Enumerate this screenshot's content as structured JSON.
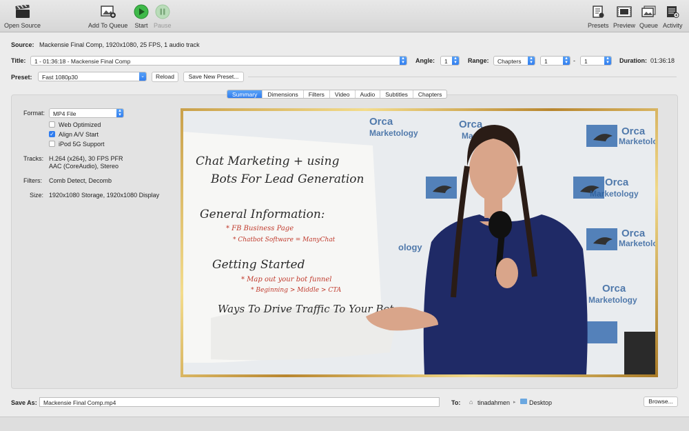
{
  "toolbar": {
    "open_source": "Open Source",
    "add_to_queue": "Add To Queue",
    "start": "Start",
    "pause": "Pause",
    "presets": "Presets",
    "preview": "Preview",
    "queue": "Queue",
    "activity": "Activity"
  },
  "source": {
    "label": "Source:",
    "value": "Mackensie Final Comp, 1920x1080, 25 FPS, 1 audio track"
  },
  "title_row": {
    "label": "Title:",
    "value": "1 - 01:36:18 - Mackensie Final Comp",
    "angle_label": "Angle:",
    "angle_value": "1",
    "range_label": "Range:",
    "range_type": "Chapters",
    "range_start": "1",
    "range_sep": "-",
    "range_end": "1",
    "duration_label": "Duration:",
    "duration_value": "01:36:18"
  },
  "preset_row": {
    "label": "Preset:",
    "value": "Fast 1080p30",
    "reload": "Reload",
    "save_new": "Save New Preset..."
  },
  "tabs": [
    {
      "label": "Summary",
      "active": true
    },
    {
      "label": "Dimensions",
      "active": false
    },
    {
      "label": "Filters",
      "active": false
    },
    {
      "label": "Video",
      "active": false
    },
    {
      "label": "Audio",
      "active": false
    },
    {
      "label": "Subtitles",
      "active": false
    },
    {
      "label": "Chapters",
      "active": false
    }
  ],
  "summary": {
    "format_label": "Format:",
    "format_value": "MP4 File",
    "web_optimized": {
      "label": "Web Optimized",
      "checked": false
    },
    "align_av": {
      "label": "Align A/V Start",
      "checked": true
    },
    "ipod": {
      "label": "iPod 5G Support",
      "checked": false
    },
    "tracks_label": "Tracks:",
    "tracks_line1": "H.264 (x264), 30 FPS PFR",
    "tracks_line2": "AAC (CoreAudio), Stereo",
    "filters_label": "Filters:",
    "filters_value": "Comb Detect, Decomb",
    "size_label": "Size:",
    "size_value": "1920x1080 Storage, 1920x1080 Display"
  },
  "preview_image": {
    "whiteboard": {
      "line1": "Chat Marketing + using",
      "line2": "Bots For Lead Generation",
      "line3": "General Information:",
      "line4": "* FB Business Page",
      "line5": "* Chatbot Software = ManyChat",
      "line6": "Getting Started",
      "line7": "* Map out your bot funnel",
      "line8": "* Beginning > Middle > CTA",
      "line9": "Ways To Drive Traffic To Your Bot"
    },
    "logo_top": "Orca",
    "logo_bottom": "Marketology",
    "logo_small": "ology"
  },
  "save_row": {
    "label": "Save As:",
    "value": "Mackensie Final Comp.mp4",
    "to_label": "To:",
    "user": "tinadahmen",
    "sep": "▸",
    "folder": "Desktop",
    "browse": "Browse..."
  },
  "colors": {
    "accent": "#2f7cef",
    "start_green": "#3fb94a",
    "frame_gold": "#d6b054",
    "marker_red": "#c0392b"
  }
}
